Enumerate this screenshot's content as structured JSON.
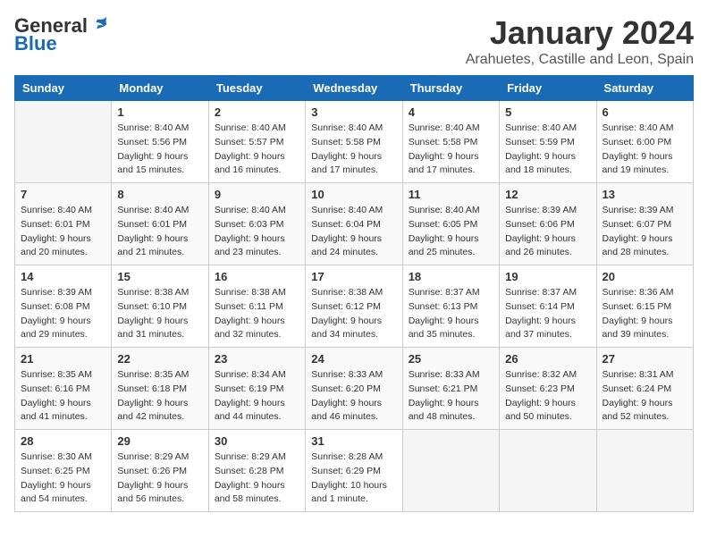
{
  "logo": {
    "general": "General",
    "blue": "Blue"
  },
  "title": "January 2024",
  "location": "Arahuetes, Castille and Leon, Spain",
  "weekdays": [
    "Sunday",
    "Monday",
    "Tuesday",
    "Wednesday",
    "Thursday",
    "Friday",
    "Saturday"
  ],
  "weeks": [
    [
      {
        "day": "",
        "info": ""
      },
      {
        "day": "1",
        "info": "Sunrise: 8:40 AM\nSunset: 5:56 PM\nDaylight: 9 hours\nand 15 minutes."
      },
      {
        "day": "2",
        "info": "Sunrise: 8:40 AM\nSunset: 5:57 PM\nDaylight: 9 hours\nand 16 minutes."
      },
      {
        "day": "3",
        "info": "Sunrise: 8:40 AM\nSunset: 5:58 PM\nDaylight: 9 hours\nand 17 minutes."
      },
      {
        "day": "4",
        "info": "Sunrise: 8:40 AM\nSunset: 5:58 PM\nDaylight: 9 hours\nand 17 minutes."
      },
      {
        "day": "5",
        "info": "Sunrise: 8:40 AM\nSunset: 5:59 PM\nDaylight: 9 hours\nand 18 minutes."
      },
      {
        "day": "6",
        "info": "Sunrise: 8:40 AM\nSunset: 6:00 PM\nDaylight: 9 hours\nand 19 minutes."
      }
    ],
    [
      {
        "day": "7",
        "info": ""
      },
      {
        "day": "8",
        "info": "Sunrise: 8:40 AM\nSunset: 6:01 PM\nDaylight: 9 hours\nand 21 minutes."
      },
      {
        "day": "9",
        "info": "Sunrise: 8:40 AM\nSunset: 6:03 PM\nDaylight: 9 hours\nand 23 minutes."
      },
      {
        "day": "10",
        "info": "Sunrise: 8:40 AM\nSunset: 6:04 PM\nDaylight: 9 hours\nand 24 minutes."
      },
      {
        "day": "11",
        "info": "Sunrise: 8:40 AM\nSunset: 6:05 PM\nDaylight: 9 hours\nand 25 minutes."
      },
      {
        "day": "12",
        "info": "Sunrise: 8:39 AM\nSunset: 6:06 PM\nDaylight: 9 hours\nand 26 minutes."
      },
      {
        "day": "13",
        "info": "Sunrise: 8:39 AM\nSunset: 6:07 PM\nDaylight: 9 hours\nand 28 minutes."
      }
    ],
    [
      {
        "day": "14",
        "info": ""
      },
      {
        "day": "15",
        "info": "Sunrise: 8:38 AM\nSunset: 6:10 PM\nDaylight: 9 hours\nand 31 minutes."
      },
      {
        "day": "16",
        "info": "Sunrise: 8:38 AM\nSunset: 6:11 PM\nDaylight: 9 hours\nand 32 minutes."
      },
      {
        "day": "17",
        "info": "Sunrise: 8:38 AM\nSunset: 6:12 PM\nDaylight: 9 hours\nand 34 minutes."
      },
      {
        "day": "18",
        "info": "Sunrise: 8:37 AM\nSunset: 6:13 PM\nDaylight: 9 hours\nand 35 minutes."
      },
      {
        "day": "19",
        "info": "Sunrise: 8:37 AM\nSunset: 6:14 PM\nDaylight: 9 hours\nand 37 minutes."
      },
      {
        "day": "20",
        "info": "Sunrise: 8:36 AM\nSunset: 6:15 PM\nDaylight: 9 hours\nand 39 minutes."
      }
    ],
    [
      {
        "day": "21",
        "info": ""
      },
      {
        "day": "22",
        "info": "Sunrise: 8:35 AM\nSunset: 6:18 PM\nDaylight: 9 hours\nand 42 minutes."
      },
      {
        "day": "23",
        "info": "Sunrise: 8:34 AM\nSunset: 6:19 PM\nDaylight: 9 hours\nand 44 minutes."
      },
      {
        "day": "24",
        "info": "Sunrise: 8:33 AM\nSunset: 6:20 PM\nDaylight: 9 hours\nand 46 minutes."
      },
      {
        "day": "25",
        "info": "Sunrise: 8:33 AM\nSunset: 6:21 PM\nDaylight: 9 hours\nand 48 minutes."
      },
      {
        "day": "26",
        "info": "Sunrise: 8:32 AM\nSunset: 6:23 PM\nDaylight: 9 hours\nand 50 minutes."
      },
      {
        "day": "27",
        "info": "Sunrise: 8:31 AM\nSunset: 6:24 PM\nDaylight: 9 hours\nand 52 minutes."
      }
    ],
    [
      {
        "day": "28",
        "info": "Sunrise: 8:30 AM\nSunset: 6:25 PM\nDaylight: 9 hours\nand 54 minutes."
      },
      {
        "day": "29",
        "info": "Sunrise: 8:29 AM\nSunset: 6:26 PM\nDaylight: 9 hours\nand 56 minutes."
      },
      {
        "day": "30",
        "info": "Sunrise: 8:29 AM\nSunset: 6:28 PM\nDaylight: 9 hours\nand 58 minutes."
      },
      {
        "day": "31",
        "info": "Sunrise: 8:28 AM\nSunset: 6:29 PM\nDaylight: 10 hours\nand 1 minute."
      },
      {
        "day": "",
        "info": ""
      },
      {
        "day": "",
        "info": ""
      },
      {
        "day": "",
        "info": ""
      }
    ]
  ],
  "week7_sunday": "Sunrise: 8:40 AM\nSunset: 6:01 PM\nDaylight: 9 hours\nand 20 minutes.",
  "week14_sunday": "Sunrise: 8:39 AM\nSunset: 6:08 PM\nDaylight: 9 hours\nand 29 minutes.",
  "week21_sunday": "Sunrise: 8:35 AM\nSunset: 6:16 PM\nDaylight: 9 hours\nand 41 minutes."
}
